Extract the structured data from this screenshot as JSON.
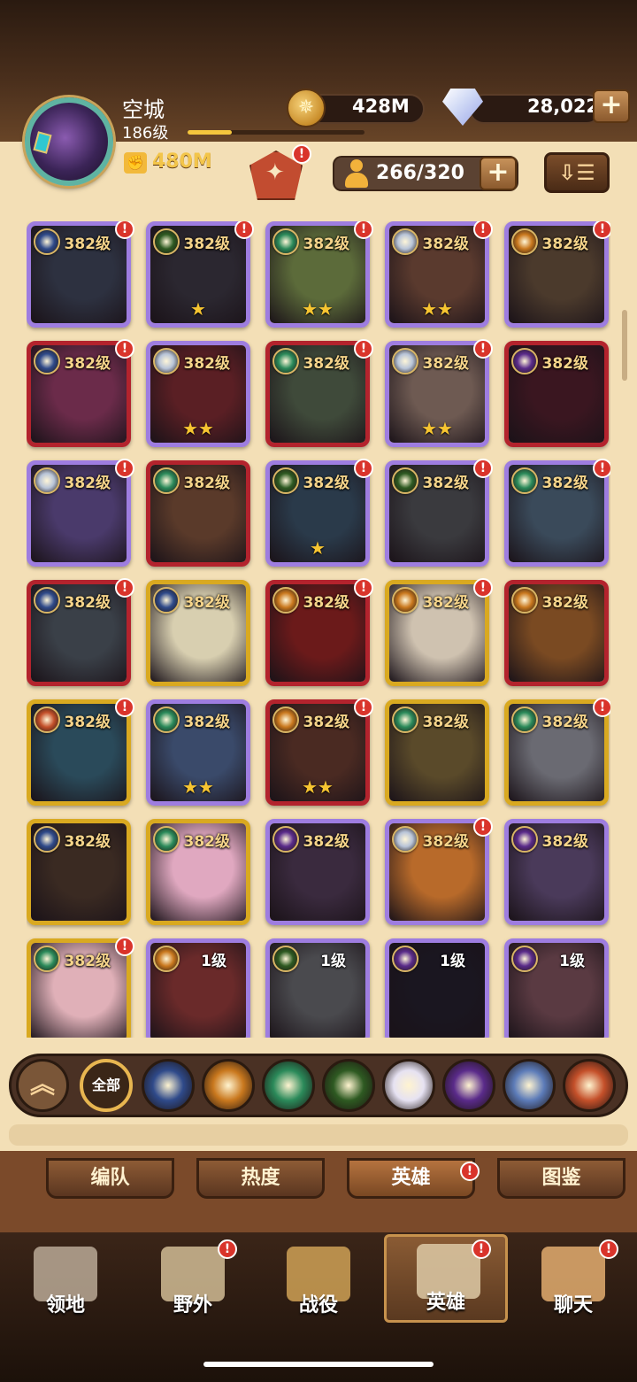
{
  "player": {
    "name": "空城",
    "level": "186级",
    "xp_fraction": 0.25,
    "power": "480M"
  },
  "currency": {
    "gold": "428M",
    "diamonds": "28,022"
  },
  "hero_count": "266/320",
  "badge_mark": "!",
  "plus_label": "+",
  "sort_icon": "sort-icon",
  "hero_rows": [
    [
      {
        "level": "382级",
        "faction": "lightbearer",
        "rarity": "purple",
        "stars": "",
        "color": "#2d3140",
        "badge": true
      },
      {
        "level": "382级",
        "faction": "graveborn",
        "rarity": "purple",
        "stars": "★",
        "color": "#2b2730",
        "badge": true
      },
      {
        "level": "382级",
        "faction": "wilder",
        "rarity": "purple",
        "stars": "★★",
        "color": "#5c6b3a",
        "badge": true
      },
      {
        "level": "382级",
        "faction": "celestial",
        "rarity": "purple",
        "stars": "★★",
        "color": "#5a3a2e",
        "badge": true
      },
      {
        "level": "382级",
        "faction": "mauler",
        "rarity": "purple",
        "stars": "",
        "color": "#4b3a2c",
        "badge": true
      }
    ],
    [
      {
        "level": "382级",
        "faction": "lightbearer",
        "rarity": "red",
        "stars": "",
        "color": "#6b2b4a",
        "badge": true
      },
      {
        "level": "382级",
        "faction": "celestial",
        "rarity": "purple",
        "stars": "★★",
        "color": "#5a1f24",
        "badge": false
      },
      {
        "level": "382级",
        "faction": "wilder",
        "rarity": "red",
        "stars": "",
        "color": "#3f4a3a",
        "badge": true
      },
      {
        "level": "382级",
        "faction": "celestial",
        "rarity": "purple",
        "stars": "★★",
        "color": "#6e5a52",
        "badge": true
      },
      {
        "level": "382级",
        "faction": "hypogean",
        "rarity": "red",
        "stars": "",
        "color": "#3a1620",
        "badge": false
      }
    ],
    [
      {
        "level": "382级",
        "faction": "celestial",
        "rarity": "purple",
        "stars": "",
        "color": "#4a3a6b",
        "badge": true
      },
      {
        "level": "382级",
        "faction": "wilder",
        "rarity": "red",
        "stars": "",
        "color": "#5a3a2a",
        "badge": false
      },
      {
        "level": "382级",
        "faction": "graveborn",
        "rarity": "purple",
        "stars": "★",
        "color": "#2a3a4a",
        "badge": true
      },
      {
        "level": "382级",
        "faction": "graveborn",
        "rarity": "purple",
        "stars": "",
        "color": "#3a3a3e",
        "badge": true
      },
      {
        "level": "382级",
        "faction": "wilder",
        "rarity": "purple",
        "stars": "",
        "color": "#3a4a5a",
        "badge": true
      }
    ],
    [
      {
        "level": "382级",
        "faction": "lightbearer",
        "rarity": "red",
        "stars": "",
        "color": "#3a4048",
        "badge": true
      },
      {
        "level": "382级",
        "faction": "lightbearer",
        "rarity": "gold",
        "stars": "",
        "color": "#d8cfb0",
        "badge": false
      },
      {
        "level": "382级",
        "faction": "mauler",
        "rarity": "red",
        "stars": "",
        "color": "#6b1a1a",
        "badge": true
      },
      {
        "level": "382级",
        "faction": "mauler",
        "rarity": "gold",
        "stars": "",
        "color": "#cfc2b0",
        "badge": true
      },
      {
        "level": "382级",
        "faction": "mauler",
        "rarity": "red",
        "stars": "",
        "color": "#7a4a22",
        "badge": false
      }
    ],
    [
      {
        "level": "382级",
        "faction": "dimensional",
        "rarity": "gold",
        "stars": "",
        "color": "#2a4a5a",
        "badge": true
      },
      {
        "level": "382级",
        "faction": "wilder",
        "rarity": "purple",
        "stars": "★★",
        "color": "#3a4a6a",
        "badge": false
      },
      {
        "level": "382级",
        "faction": "mauler",
        "rarity": "red",
        "stars": "★★",
        "color": "#4a2a22",
        "badge": true
      },
      {
        "level": "382级",
        "faction": "wilder",
        "rarity": "gold",
        "stars": "",
        "color": "#5a4a2a",
        "badge": false
      },
      {
        "level": "382级",
        "faction": "wilder",
        "rarity": "gold",
        "stars": "",
        "color": "#6a6a72",
        "badge": true
      }
    ],
    [
      {
        "level": "382级",
        "faction": "lightbearer",
        "rarity": "gold",
        "stars": "",
        "color": "#3a2a22",
        "badge": false
      },
      {
        "level": "382级",
        "faction": "wilder",
        "rarity": "gold",
        "stars": "",
        "color": "#e0a8c0",
        "badge": false
      },
      {
        "level": "382级",
        "faction": "hypogean",
        "rarity": "purple",
        "stars": "",
        "color": "#3a2a3e",
        "badge": false
      },
      {
        "level": "382级",
        "faction": "celestial",
        "rarity": "purple",
        "stars": "",
        "color": "#b86a2a",
        "badge": true
      },
      {
        "level": "382级",
        "faction": "hypogean",
        "rarity": "purple",
        "stars": "",
        "color": "#4a3a5a",
        "badge": false
      }
    ],
    [
      {
        "level": "382级",
        "faction": "wilder",
        "rarity": "gold",
        "stars": "",
        "color": "#e0b0b8",
        "badge": true
      },
      {
        "level": "1级",
        "faction": "mauler",
        "rarity": "purple",
        "stars": "",
        "color": "#6a2a2a",
        "badge": false
      },
      {
        "level": "1级",
        "faction": "graveborn",
        "rarity": "purple",
        "stars": "",
        "color": "#4a4a4e",
        "badge": false
      },
      {
        "level": "1级",
        "faction": "hypogean",
        "rarity": "purple",
        "stars": "",
        "color": "#1a1620",
        "badge": false
      },
      {
        "level": "1级",
        "faction": "hypogean",
        "rarity": "purple",
        "stars": "",
        "color": "#5a3a42",
        "badge": false
      }
    ]
  ],
  "faction_colors": {
    "lightbearer": "#2f4a8a",
    "mauler": "#c9781e",
    "wilder": "#2b8a5a",
    "graveborn": "#2e5a22",
    "celestial": "#b8c4d8",
    "hypogean": "#5a2b8a",
    "dimensional": "#c4502a"
  },
  "filters": {
    "up_icon": "︽",
    "all_label": "全部",
    "items": [
      {
        "name": "lightbearer-filter-icon",
        "color": "#2f4a8a"
      },
      {
        "name": "mauler-filter-icon",
        "color": "#c9781e"
      },
      {
        "name": "wilder-filter-icon",
        "color": "#2b8a5a"
      },
      {
        "name": "graveborn-filter-icon",
        "color": "#2e5a22"
      },
      {
        "name": "celestial-filter-icon",
        "color": "#e6e2f2"
      },
      {
        "name": "hypogean-filter-icon",
        "color": "#5a2b8a"
      },
      {
        "name": "dimensional-lb-filter-icon",
        "color": "#5c7bb8"
      },
      {
        "name": "dimensional-filter-icon",
        "color": "#c4502a"
      }
    ]
  },
  "subtabs": [
    "编队",
    "热度",
    "英雄",
    "图鉴"
  ],
  "nav": [
    "领地",
    "野外",
    "战役",
    "英雄",
    "聊天"
  ],
  "colors": {
    "accent_gold": "#f3c54a",
    "badge_red": "#d9342b",
    "parchment": "#f3dfb6"
  }
}
